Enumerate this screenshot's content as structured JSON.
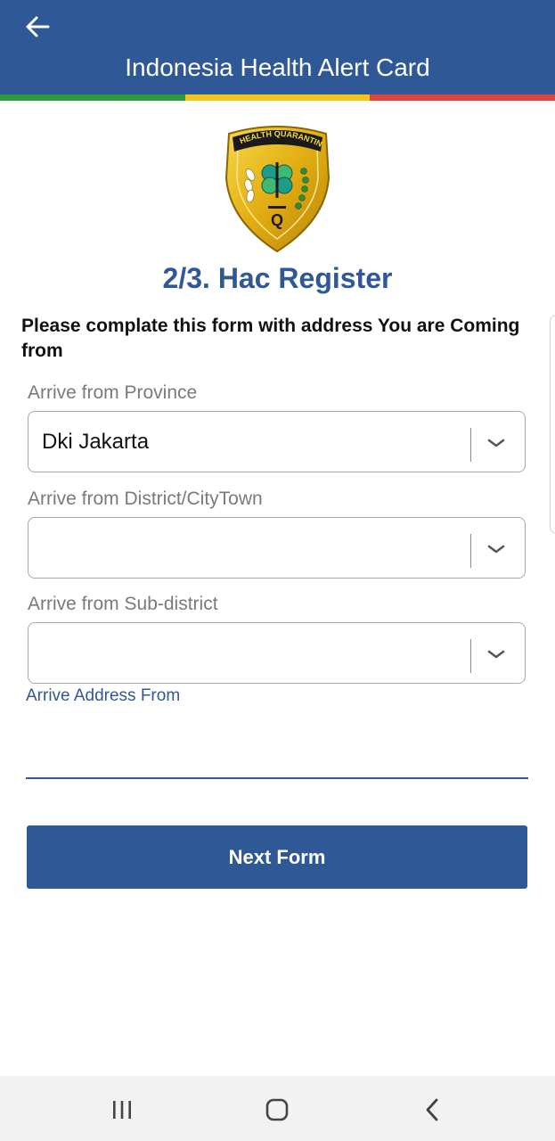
{
  "header": {
    "title": "Indonesia Health Alert Card",
    "back_icon": "arrow-left-icon",
    "stripe_colors": [
      "#2a9d3a",
      "#f5c518",
      "#e0443f"
    ],
    "bar_color": "#2f5896"
  },
  "emblem": {
    "icon": "health-quarantine-emblem",
    "text": "HEALTH QUARANTINE",
    "letter": "Q"
  },
  "form": {
    "step_title": "2/3. Hac Register",
    "instruction": "Please complate this form with address You are Coming from",
    "province": {
      "label": "Arrive from Province",
      "value": "Dki Jakarta"
    },
    "district": {
      "label": "Arrive from District/CityTown",
      "value": ""
    },
    "subdistrict": {
      "label": "Arrive from Sub-district",
      "value": ""
    },
    "address": {
      "label": "Arrive Address From",
      "value": ""
    },
    "next_button": "Next Form"
  },
  "nav": {
    "recents_icon": "recents-icon",
    "home_icon": "home-icon",
    "back_icon": "back-chevron-icon"
  }
}
